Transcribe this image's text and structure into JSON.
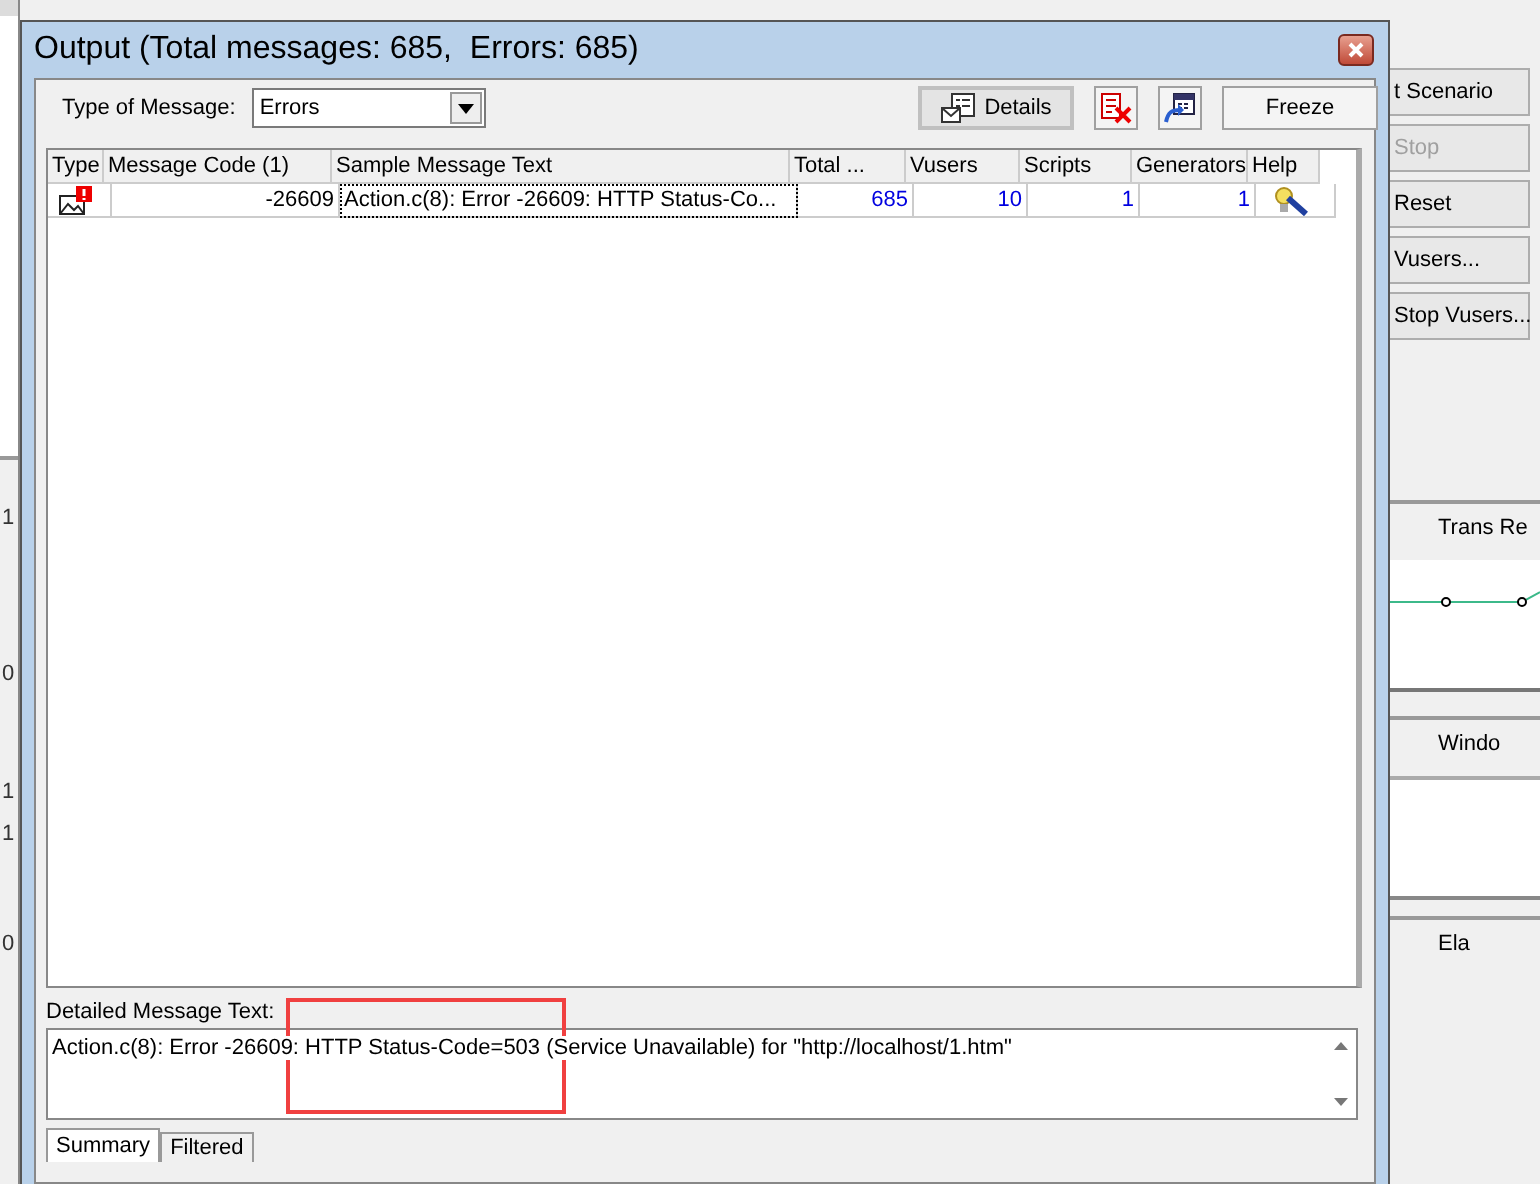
{
  "background_app": {
    "axis_labels": [
      "1",
      "0",
      "1",
      "1",
      "0"
    ],
    "buttons": [
      {
        "label": "t Scenario",
        "disabled": false
      },
      {
        "label": "Stop",
        "disabled": true
      },
      {
        "label": "Reset",
        "disabled": false
      },
      {
        "label": "Vusers...",
        "disabled": false
      },
      {
        "label": "Stop Vusers...",
        "disabled": false
      }
    ],
    "panels": [
      {
        "title": "Trans Re"
      },
      {
        "title": "Windo"
      },
      {
        "title": "Ela"
      }
    ]
  },
  "window": {
    "title": "Output (Total messages: 685,  Errors: 685)"
  },
  "filter": {
    "label": "Type of Message:",
    "value": "Errors"
  },
  "toolbar": {
    "details": "Details",
    "freeze": "Freeze"
  },
  "table": {
    "columns": [
      "Type",
      "Message Code (1)",
      "Sample Message Text",
      "Total ...",
      "Vusers",
      "Scripts",
      "Generators",
      "Help"
    ],
    "rows": [
      {
        "message_code": "-26609",
        "sample_text": "Action.c(8): Error -26609: HTTP Status-Co...",
        "total": "685",
        "vusers": "10",
        "scripts": "1",
        "generators": "1",
        "focused": true
      }
    ]
  },
  "detail": {
    "label": "Detailed Message Text:",
    "text": "Action.c(8): Error -26609: HTTP Status-Code=503 (Service Unavailable) for \"http://localhost/1.htm\"",
    "highlight": true
  },
  "tabs": [
    {
      "label": "Summary",
      "selected": true
    },
    {
      "label": "Filtered",
      "selected": false
    }
  ]
}
